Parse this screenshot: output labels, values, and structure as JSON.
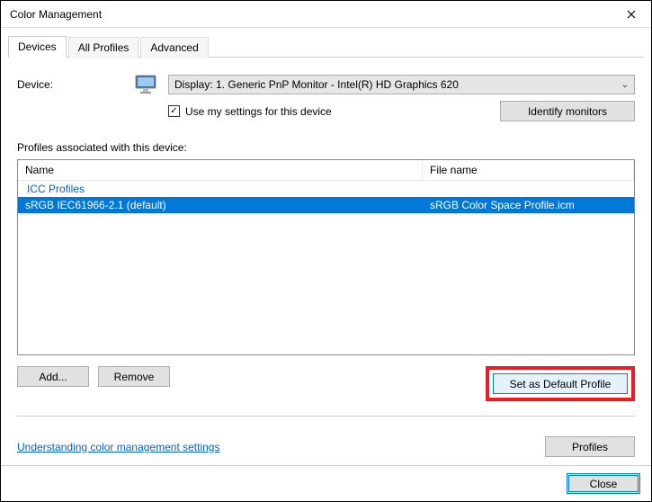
{
  "window": {
    "title": "Color Management"
  },
  "tabs": {
    "devices": "Devices",
    "all_profiles": "All Profiles",
    "advanced": "Advanced"
  },
  "device": {
    "label": "Device:",
    "selected": "Display: 1. Generic PnP Monitor - Intel(R) HD Graphics 620",
    "use_my_settings": "Use my settings for this device",
    "identify": "Identify monitors"
  },
  "profiles": {
    "section_label": "Profiles associated with this device:",
    "columns": {
      "name": "Name",
      "file": "File name"
    },
    "group": "ICC Profiles",
    "items": [
      {
        "name": "sRGB IEC61966-2.1 (default)",
        "file": "sRGB Color Space Profile.icm"
      }
    ]
  },
  "buttons": {
    "add": "Add...",
    "remove": "Remove",
    "set_default": "Set as Default Profile",
    "profiles": "Profiles",
    "close": "Close"
  },
  "link": {
    "understanding": "Understanding color management settings"
  }
}
